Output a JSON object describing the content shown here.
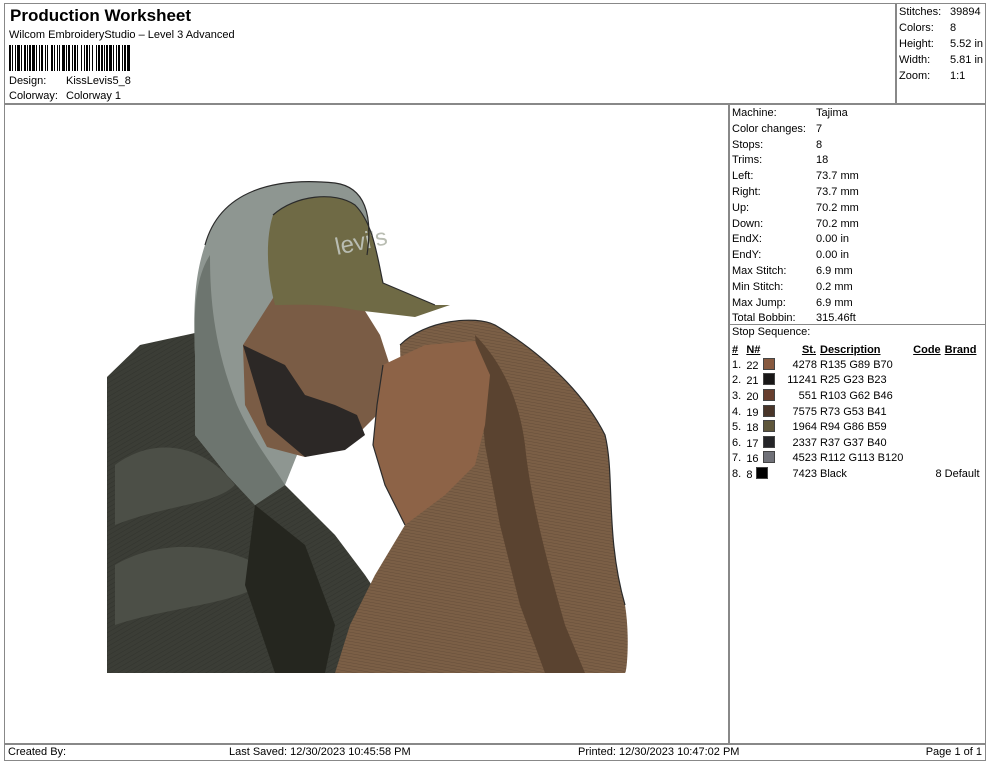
{
  "header": {
    "title": "Production Worksheet",
    "subtitle": "Wilcom EmbroideryStudio – Level 3 Advanced",
    "design_label": "Design:",
    "design_value": "KissLevis5_8",
    "colorway_label": "Colorway:",
    "colorway_value": "Colorway 1"
  },
  "stats": [
    {
      "label": "Stitches:",
      "value": "39894"
    },
    {
      "label": "Colors:",
      "value": "8"
    },
    {
      "label": "Height:",
      "value": "5.52 in"
    },
    {
      "label": "Width:",
      "value": "5.81 in"
    },
    {
      "label": "Zoom:",
      "value": "1:1"
    }
  ],
  "machine_info": [
    {
      "label": "Machine:",
      "value": "Tajima"
    },
    {
      "label": "Color changes:",
      "value": "7"
    },
    {
      "label": "Stops:",
      "value": "8"
    },
    {
      "label": "Trims:",
      "value": "18"
    },
    {
      "label": "Left:",
      "value": "73.7 mm"
    },
    {
      "label": "Right:",
      "value": "73.7 mm"
    },
    {
      "label": "Up:",
      "value": "70.2 mm"
    },
    {
      "label": "Down:",
      "value": "70.2 mm"
    },
    {
      "label": "EndX:",
      "value": "0.00 in"
    },
    {
      "label": "EndY:",
      "value": "0.00 in"
    },
    {
      "label": "Max Stitch:",
      "value": "6.9 mm"
    },
    {
      "label": "Min Stitch:",
      "value": "0.2 mm"
    },
    {
      "label": "Max Jump:",
      "value": "6.9 mm"
    },
    {
      "label": "Total Bobbin:",
      "value": "315.46ft"
    }
  ],
  "stop_sequence": {
    "title": "Stop Sequence:",
    "headers": [
      "#",
      "N#",
      "St.",
      "Description",
      "Code",
      "Brand"
    ],
    "rows": [
      {
        "num": "1.",
        "n": "22",
        "color": "#87593f",
        "st": "4278",
        "desc": "R135 G89 B70",
        "code": "",
        "brand": ""
      },
      {
        "num": "2.",
        "n": "21",
        "color": "#191717",
        "st": "11241",
        "desc": "R25 G23 B23",
        "code": "",
        "brand": ""
      },
      {
        "num": "3.",
        "n": "20",
        "color": "#673e2e",
        "st": "551",
        "desc": "R103 G62 B46",
        "code": "",
        "brand": ""
      },
      {
        "num": "4.",
        "n": "19",
        "color": "#493529",
        "st": "7575",
        "desc": "R73 G53 B41",
        "code": "",
        "brand": ""
      },
      {
        "num": "5.",
        "n": "18",
        "color": "#5e563b",
        "st": "1964",
        "desc": "R94 G86 B59",
        "code": "",
        "brand": ""
      },
      {
        "num": "6.",
        "n": "17",
        "color": "#252528",
        "st": "2337",
        "desc": "R37 G37 B40",
        "code": "",
        "brand": ""
      },
      {
        "num": "7.",
        "n": "16",
        "color": "#707178",
        "st": "4523",
        "desc": "R112 G113 B120",
        "code": "",
        "brand": ""
      },
      {
        "num": "8.",
        "n": "8",
        "color": "#000000",
        "st": "7423",
        "desc": "Black",
        "code": "8",
        "brand": "Default"
      }
    ]
  },
  "artwork": {
    "cap_text": "levi's",
    "colors": {
      "hood": "#8e9691",
      "hood_shadow": "#6d756f",
      "jacket": "#3b3d36",
      "jacket_mid": "#4c4f47",
      "jacket_dark": "#25261f",
      "cap": "#6f6a45",
      "cap_text": "#b9bdb2",
      "skin_man": "#7a5c45",
      "beard": "#2c2826",
      "skin_woman": "#8d6347",
      "hair": "#7b5f46",
      "hair_dark": "#5a4330",
      "outline": "#2b2b2b"
    }
  },
  "footer": {
    "created_by": "Created By:",
    "last_saved": "Last Saved: 12/30/2023 10:45:58 PM",
    "printed": "Printed: 12/30/2023 10:47:02 PM",
    "page": "Page 1 of 1"
  }
}
